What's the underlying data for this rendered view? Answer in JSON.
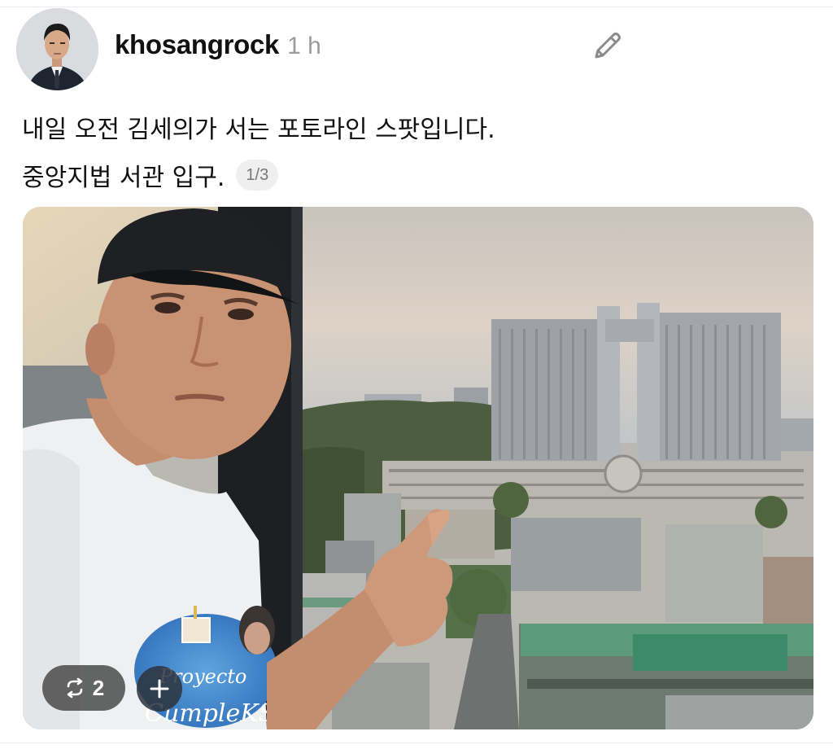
{
  "post": {
    "username": "khosangrock",
    "timestamp": "1 h",
    "text_line_1": "내일 오전 김세의가 서는 포토라인 스팟입니다.",
    "text_line_2": "중앙지법 서관 입구.",
    "page_indicator": "1/3"
  },
  "media": {
    "repost_count": "2",
    "shirt_print_line_1": "Proyecto",
    "shirt_print_line_2": "CumpleKSH"
  },
  "icons": {
    "edit": "pencil-icon",
    "repost": "repost-icon",
    "add": "plus-icon"
  },
  "colors": {
    "username": "#111111",
    "timestamp": "#9b9b9b",
    "badge_bg": "#efefef",
    "overlay_pill": "#3c3c3c"
  }
}
